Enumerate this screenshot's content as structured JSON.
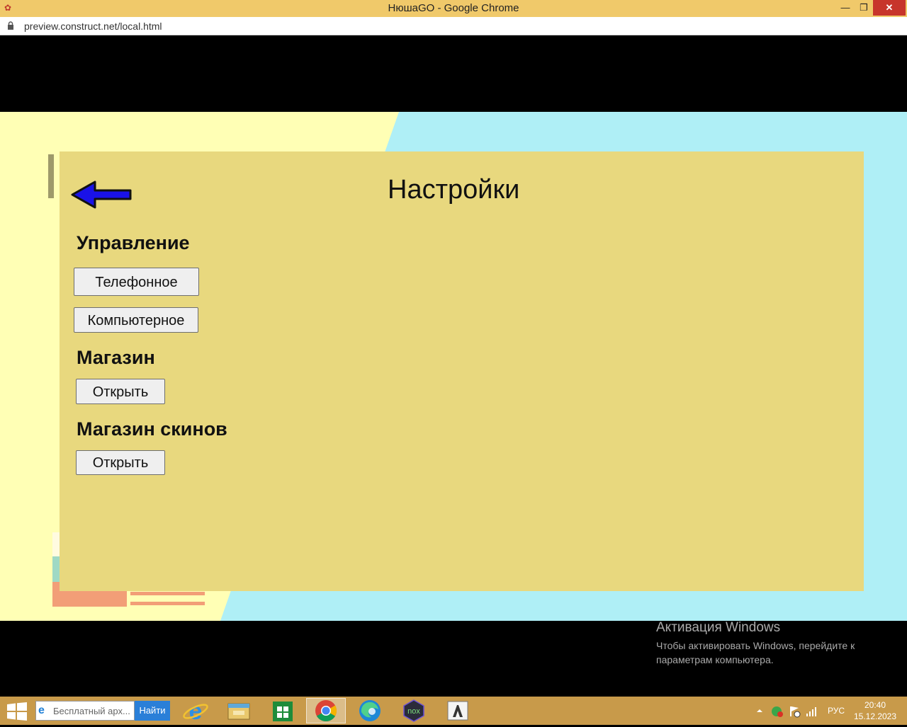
{
  "window": {
    "title": "НюшаGO - Google Chrome",
    "minimize": "—",
    "maximize": "❐",
    "close": "✕",
    "url": "preview.construct.net/local.html"
  },
  "game": {
    "colors": {
      "panel": "#e8d87e",
      "yellow": "#ffffb5",
      "cyan": "#afeff6",
      "arrow": "#1a12e8"
    },
    "settings": {
      "title": "Настройки",
      "controls_heading": "Управление",
      "phone_button": "Телефонное",
      "computer_button": "Компьютерное",
      "shop_heading": "Магазин",
      "shop_open_button": "Открыть",
      "skins_heading": "Магазин скинов",
      "skins_open_button": "Открыть"
    }
  },
  "activation": {
    "title": "Активация Windows",
    "subtitle": "Чтобы активировать Windows, перейдите к параметрам компьютера."
  },
  "taskbar": {
    "search_placeholder": "Бесплатный арх...",
    "search_button": "Найти",
    "language": "РУС",
    "time": "20:40",
    "date": "15.12.2023"
  }
}
